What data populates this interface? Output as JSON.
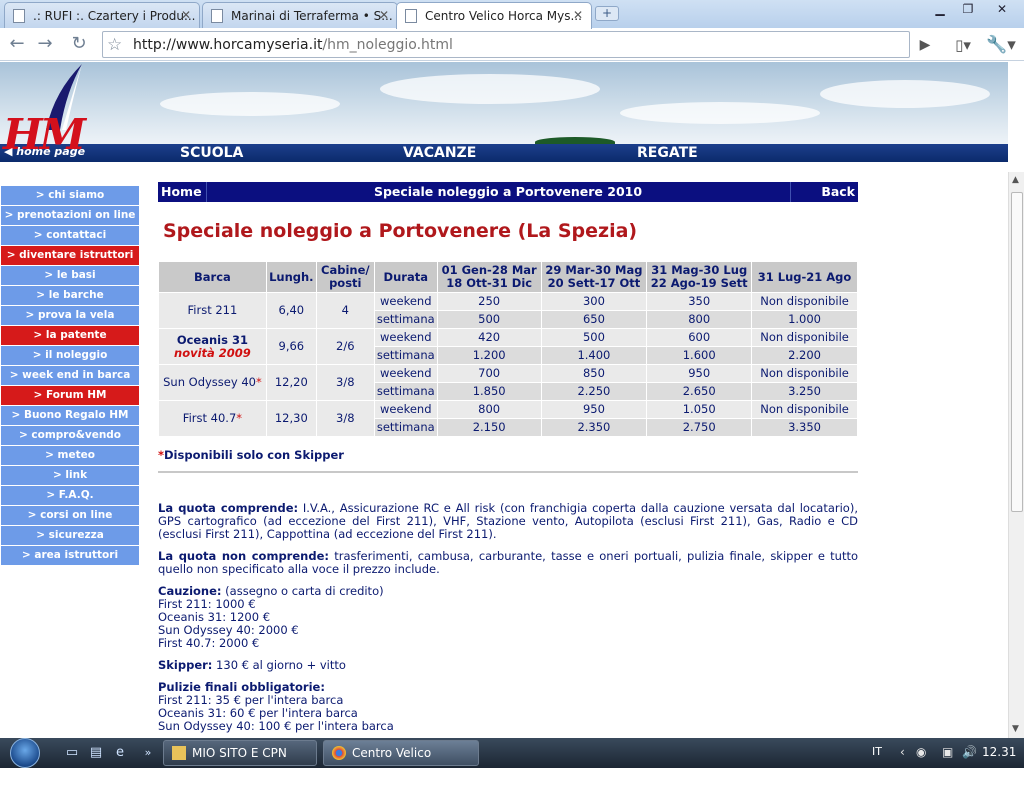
{
  "browser": {
    "tabs": [
      {
        "label": ".: RUFI :. Czartery i Produ..."
      },
      {
        "label": "Marinai di Terraferma • S..."
      },
      {
        "label": "Centro Velico Horca Mys..."
      }
    ],
    "url_host": "http://www.horcamyseria.it",
    "url_path": "/hm_noleggio.html"
  },
  "site": {
    "logo": "HM",
    "home_link": "home page",
    "nav": [
      "SCUOLA",
      "VACANZE",
      "REGATE"
    ]
  },
  "menu": [
    {
      "label": "> chi siamo",
      "highlight": false
    },
    {
      "label": "> prenotazioni on line",
      "highlight": false
    },
    {
      "label": "> contattaci",
      "highlight": false
    },
    {
      "label": "> diventare istruttori",
      "highlight": true
    },
    {
      "label": "> le basi",
      "highlight": false
    },
    {
      "label": "> le barche",
      "highlight": false
    },
    {
      "label": "> prova la vela",
      "highlight": false
    },
    {
      "label": "> la patente",
      "highlight": true
    },
    {
      "label": "> il noleggio",
      "highlight": false
    },
    {
      "label": "> week end in barca",
      "highlight": false
    },
    {
      "label": "> Forum HM",
      "highlight": true
    },
    {
      "label": "> Buono Regalo HM",
      "highlight": false
    },
    {
      "label": "> compro&vendo",
      "highlight": false
    },
    {
      "label": "> meteo",
      "highlight": false
    },
    {
      "label": "> link",
      "highlight": false
    },
    {
      "label": "> F.A.Q.",
      "highlight": false
    },
    {
      "label": "> corsi on line",
      "highlight": false
    },
    {
      "label": "> sicurezza",
      "highlight": false
    },
    {
      "label": "> area istruttori",
      "highlight": false
    }
  ],
  "content": {
    "bar_home": "Home",
    "bar_title": "Speciale noleggio a Portovenere 2010",
    "bar_back": "Back",
    "title": "Speciale noleggio a Portovenere (La Spezia)",
    "table": {
      "headers": [
        "Barca",
        "Lungh.",
        "Cabine/\nposti",
        "Durata",
        "01 Gen-28 Mar\n18 Ott-31 Dic",
        "29 Mar-30 Mag\n20 Sett-17 Ott",
        "31 Mag-30 Lug\n22 Ago-19 Sett",
        "31 Lug-21 Ago"
      ],
      "boats": [
        {
          "name": "First 211",
          "star": "",
          "sub": "",
          "length": "6,40",
          "cabins": "4",
          "rows": [
            {
              "duration": "weekend",
              "prices": [
                "250",
                "300",
                "350",
                "Non disponibile"
              ]
            },
            {
              "duration": "settimana",
              "prices": [
                "500",
                "650",
                "800",
                "1.000"
              ]
            }
          ]
        },
        {
          "name": "Oceanis 31",
          "star": "",
          "sub": "novità 2009",
          "length": "9,66",
          "cabins": "2/6",
          "rows": [
            {
              "duration": "weekend",
              "prices": [
                "420",
                "500",
                "600",
                "Non disponibile"
              ]
            },
            {
              "duration": "settimana",
              "prices": [
                "1.200",
                "1.400",
                "1.600",
                "2.200"
              ]
            }
          ]
        },
        {
          "name": "Sun Odyssey 40",
          "star": "*",
          "sub": "",
          "length": "12,20",
          "cabins": "3/8",
          "rows": [
            {
              "duration": "weekend",
              "prices": [
                "700",
                "850",
                "950",
                "Non disponibile"
              ]
            },
            {
              "duration": "settimana",
              "prices": [
                "1.850",
                "2.250",
                "2.650",
                "3.250"
              ]
            }
          ]
        },
        {
          "name": "First 40.7",
          "star": "*",
          "sub": "",
          "length": "12,30",
          "cabins": "3/8",
          "rows": [
            {
              "duration": "weekend",
              "prices": [
                "800",
                "950",
                "1.050",
                "Non disponibile"
              ]
            },
            {
              "duration": "settimana",
              "prices": [
                "2.150",
                "2.350",
                "2.750",
                "3.350"
              ]
            }
          ]
        }
      ]
    },
    "note_star": "*",
    "note": "Disponibili solo con Skipper",
    "quota_label": "La quota comprende:",
    "quota_text": " I.V.A., Assicurazione RC e All risk (con franchigia coperta dalla cauzione versata dal locatario), GPS cartografico (ad eccezione del First 211), VHF, Stazione vento, Autopilota (esclusi First 211), Gas, Radio e CD (esclusi First 211), Cappottina (ad eccezione del First 211).",
    "nonquota_label": "La quota non comprende:",
    "nonquota_text": " trasferimenti, cambusa, carburante, tasse e oneri portuali, pulizia finale, skipper e tutto quello non specificato alla voce il prezzo include.",
    "cauzione_label": "Cauzione:",
    "cauzione_text": " (assegno o carta di credito)",
    "cauzione_lines": [
      "First 211: 1000 €",
      "Oceanis 31: 1200 €",
      "Sun Odyssey 40: 2000 €",
      "First 40.7: 2000 €"
    ],
    "skipper_label": "Skipper:",
    "skipper_text": " 130 € al giorno + vitto",
    "pulizie_label": "Pulizie finali obbligatorie:",
    "pulizie_lines": [
      "First 211: 35 € per l'intera barca",
      "Oceanis 31: 60 € per l'intera barca",
      "Sun Odyssey 40: 100 € per l'intera barca"
    ]
  },
  "taskbar": {
    "tasks": [
      "MIO SITO E CPN",
      "Centro Velico Horca..."
    ],
    "lang": "IT",
    "clock": "12.31"
  }
}
